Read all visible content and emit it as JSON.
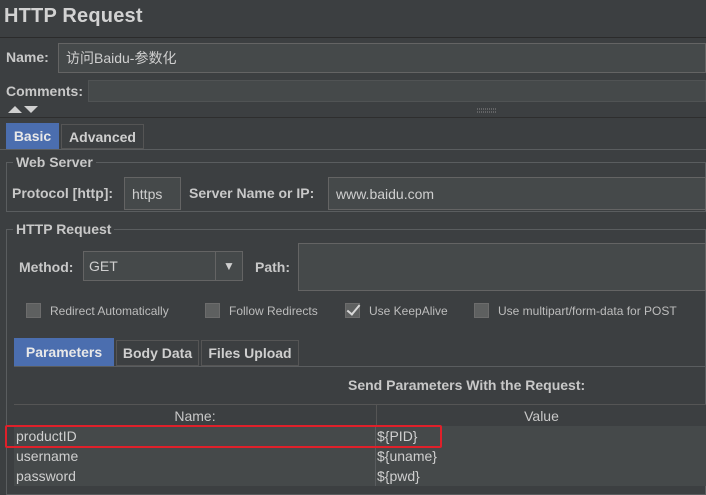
{
  "title": "HTTP Request",
  "name": {
    "label": "Name:",
    "value": "访问Baidu-参数化"
  },
  "comments": {
    "label": "Comments:",
    "value": ""
  },
  "tabs": [
    {
      "label": "Basic",
      "active": true
    },
    {
      "label": "Advanced",
      "active": false
    }
  ],
  "web_server": {
    "title": "Web Server",
    "protocol_label": "Protocol [http]:",
    "protocol_value": "https",
    "server_label": "Server Name or IP:",
    "server_value": "www.baidu.com"
  },
  "http_request": {
    "title": "HTTP Request",
    "method_label": "Method:",
    "method_value": "GET",
    "path_label": "Path:",
    "path_value": ""
  },
  "options": [
    {
      "label": "Redirect Automatically",
      "checked": false
    },
    {
      "label": "Follow Redirects",
      "checked": false
    },
    {
      "label": "Use KeepAlive",
      "checked": true
    },
    {
      "label": "Use multipart/form-data for POST",
      "checked": false
    }
  ],
  "param_tabs": [
    {
      "label": "Parameters",
      "active": true
    },
    {
      "label": "Body Data",
      "active": false
    },
    {
      "label": "Files Upload",
      "active": false
    }
  ],
  "parameters": {
    "heading": "Send Parameters With the Request:",
    "columns": [
      "Name:",
      "Value"
    ],
    "rows": [
      {
        "name": "productID",
        "value": "${PID}"
      },
      {
        "name": "username",
        "value": "${uname}"
      },
      {
        "name": "password",
        "value": "${pwd}"
      }
    ]
  },
  "colors": {
    "background": "#3c3f41",
    "active_tab": "#4b6eaf",
    "highlight": "#e0202a"
  }
}
